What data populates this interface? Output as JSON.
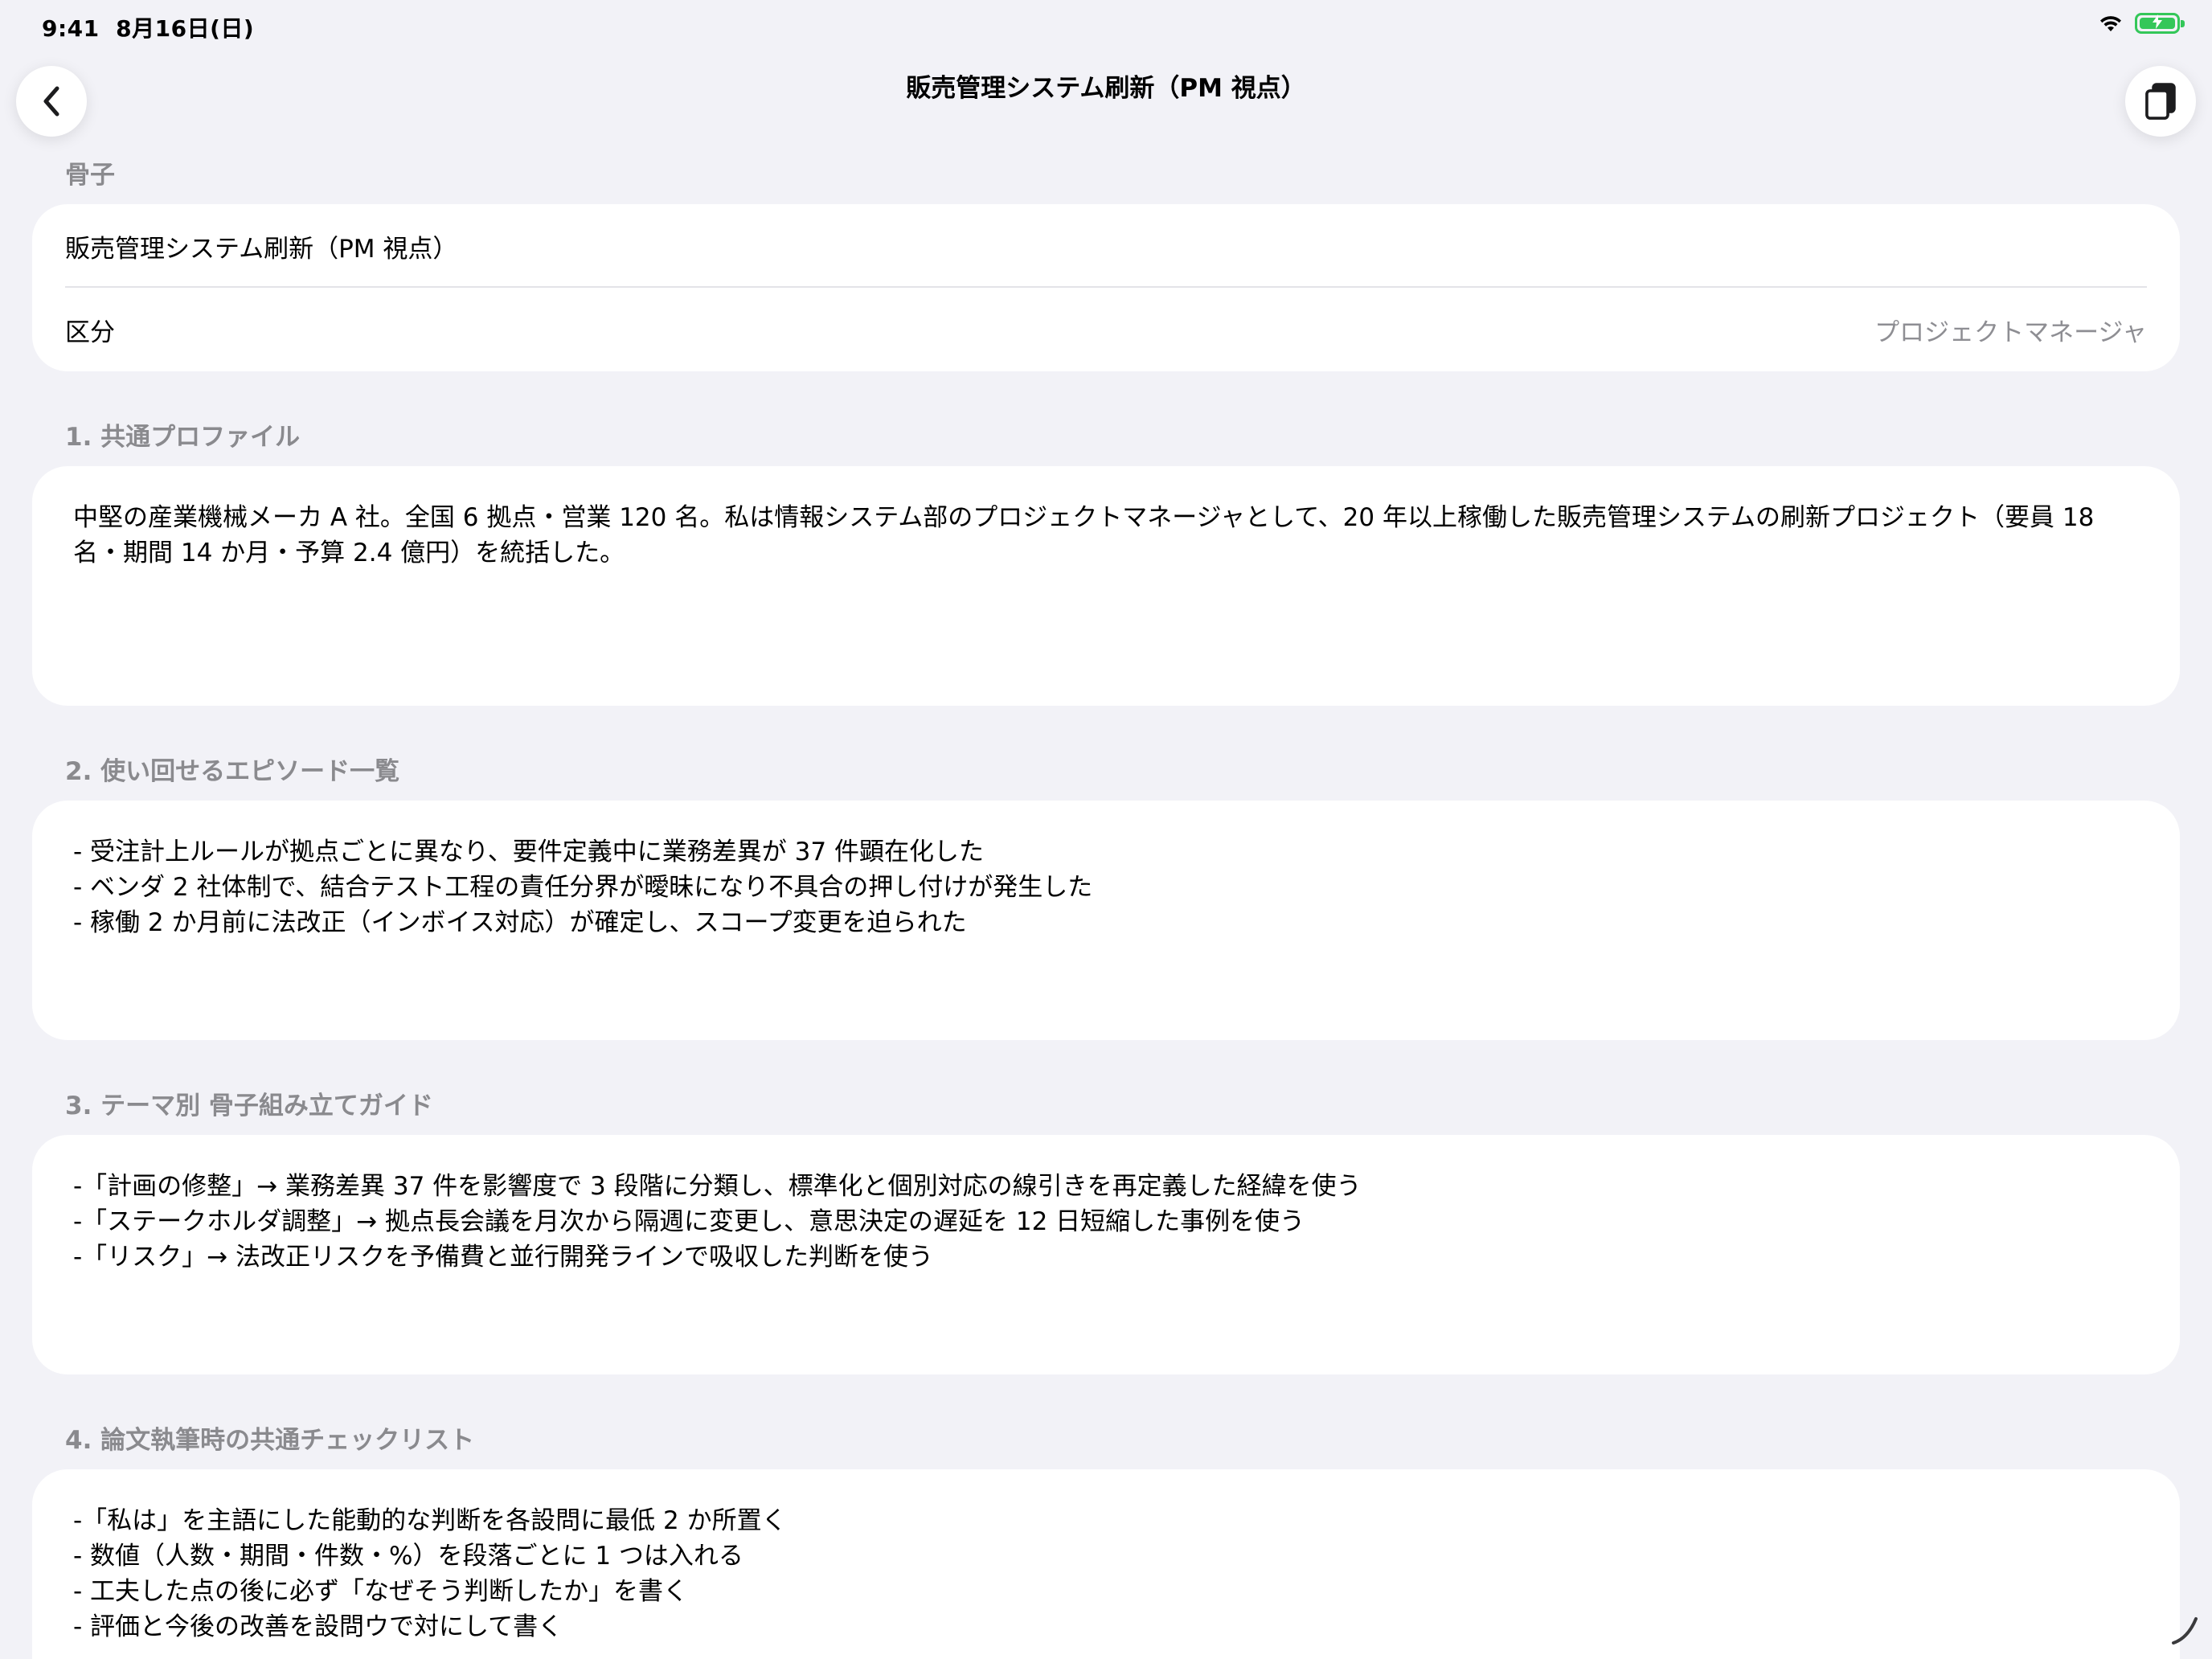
{
  "status_bar": {
    "time": "9:41",
    "date": "8月16日(日)",
    "wifi_icon": "wifi-icon",
    "battery_icon": "battery-charging-icon",
    "battery_color": "#34c759"
  },
  "nav": {
    "title": "販売管理システム刷新（PM 視点）",
    "back_icon": "chevron-left-icon",
    "copy_icon": "copy-icon"
  },
  "outline": {
    "header": "骨子",
    "title_value": "販売管理システム刷新（PM 視点）",
    "category_label": "区分",
    "category_value": "プロジェクトマネージャ"
  },
  "sections": [
    {
      "header": "1. 共通プロファイル",
      "body": "中堅の産業機械メーカ A 社。全国 6 拠点・営業 120 名。私は情報システム部のプロジェクトマネージャとして、20 年以上稼働した販売管理システムの刷新プロジェクト（要員 18 名・期間 14 か月・予算 2.4 億円）を統括した。"
    },
    {
      "header": "2. 使い回せるエピソード一覧",
      "body": "- 受注計上ルールが拠点ごとに異なり、要件定義中に業務差異が 37 件顕在化した\n- ベンダ 2 社体制で、結合テスト工程の責任分界が曖昧になり不具合の押し付けが発生した\n- 稼働 2 か月前に法改正（インボイス対応）が確定し、スコープ変更を迫られた"
    },
    {
      "header": "3. テーマ別 骨子組み立てガイド",
      "body": "-「計画の修整」→ 業務差異 37 件を影響度で 3 段階に分類し、標準化と個別対応の線引きを再定義した経緯を使う\n-「ステークホルダ調整」→ 拠点長会議を月次から隔週に変更し、意思決定の遅延を 12 日短縮した事例を使う\n-「リスク」→ 法改正リスクを予備費と並行開発ラインで吸収した判断を使う"
    },
    {
      "header": "4. 論文執筆時の共通チェックリスト",
      "body": "-「私は」を主語にした能動的な判断を各設問に最低 2 か所置く\n- 数値（人数・期間・件数・%）を段落ごとに 1 つは入れる\n- 工夫した点の後に必ず「なぜそう判断したか」を書く\n- 評価と今後の改善を設問ウで対にして書く"
    }
  ]
}
